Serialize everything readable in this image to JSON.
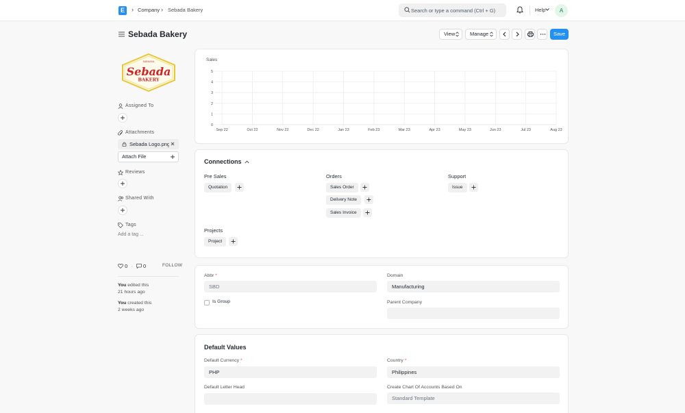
{
  "navbar": {
    "breadcrumbs": [
      "Company",
      "Sebada Bakery"
    ],
    "search_placeholder": "Search or type a command (Ctrl + G)",
    "help_label": "Help",
    "avatar_initial": "A"
  },
  "page": {
    "title": "Sebada Bakery",
    "actions": {
      "view": "View",
      "manage": "Manage",
      "save": "Save"
    }
  },
  "logo": {
    "arc_text": "SABUASA",
    "main_text": "Sebada",
    "sub_text": "BAKERY"
  },
  "sidebar": {
    "assigned_to": "Assigned To",
    "attachments": "Attachments",
    "attachment_file": "Sebada Logo.png",
    "attach_file": "Attach File",
    "reviews": "Reviews",
    "shared_with": "Shared With",
    "tags": "Tags",
    "add_tag": "Add a tag ...",
    "likes": "0",
    "dot": "·",
    "comments": "0",
    "follow": "FOLLOW",
    "activity": [
      {
        "who": "You",
        "action": "edited this",
        "when": "21 hours ago"
      },
      {
        "who": "You",
        "action": "created this",
        "when": "2 weeks ago"
      }
    ]
  },
  "chart_data": {
    "type": "line",
    "title": "Sales",
    "categories": [
      "Sep 22",
      "Oct 22",
      "Nov 22",
      "Dec 22",
      "Jan 23",
      "Feb 23",
      "Mar 23",
      "Apr 23",
      "May 23",
      "Jun 23",
      "Jul 23",
      "Aug 23"
    ],
    "y_ticks": [
      "5",
      "4",
      "3",
      "2",
      "1",
      "0"
    ],
    "ylim": [
      0,
      5
    ],
    "series": [
      {
        "values": [
          0,
          0,
          0,
          0,
          0,
          0,
          0,
          0,
          0,
          0,
          0,
          0
        ]
      }
    ],
    "grid": true
  },
  "connections": {
    "title": "Connections",
    "groups": [
      {
        "title": "Pre Sales",
        "items": [
          "Quotation"
        ]
      },
      {
        "title": "Orders",
        "items": [
          "Sales Order",
          "Delivery Note",
          "Sales Invoice"
        ]
      },
      {
        "title": "Support",
        "items": [
          "Issue"
        ]
      },
      {
        "title": "Projects",
        "items": [
          "Project"
        ]
      }
    ]
  },
  "form": {
    "abbr_label": "Abbr",
    "abbr_value": "SBD",
    "is_group_label": "Is Group",
    "domain_label": "Domain",
    "domain_value": "Manufacturing",
    "parent_company_label": "Parent Company",
    "parent_company_value": ""
  },
  "defaults": {
    "title": "Default Values",
    "currency_label": "Default Currency",
    "currency_value": "PHP",
    "country_label": "Country",
    "country_value": "Philippines",
    "letter_head_label": "Default Letter Head",
    "letter_head_value": "",
    "coa_label": "Create Chart Of Accounts Based On",
    "coa_value": "Standard Template",
    "required_mark": "*"
  }
}
